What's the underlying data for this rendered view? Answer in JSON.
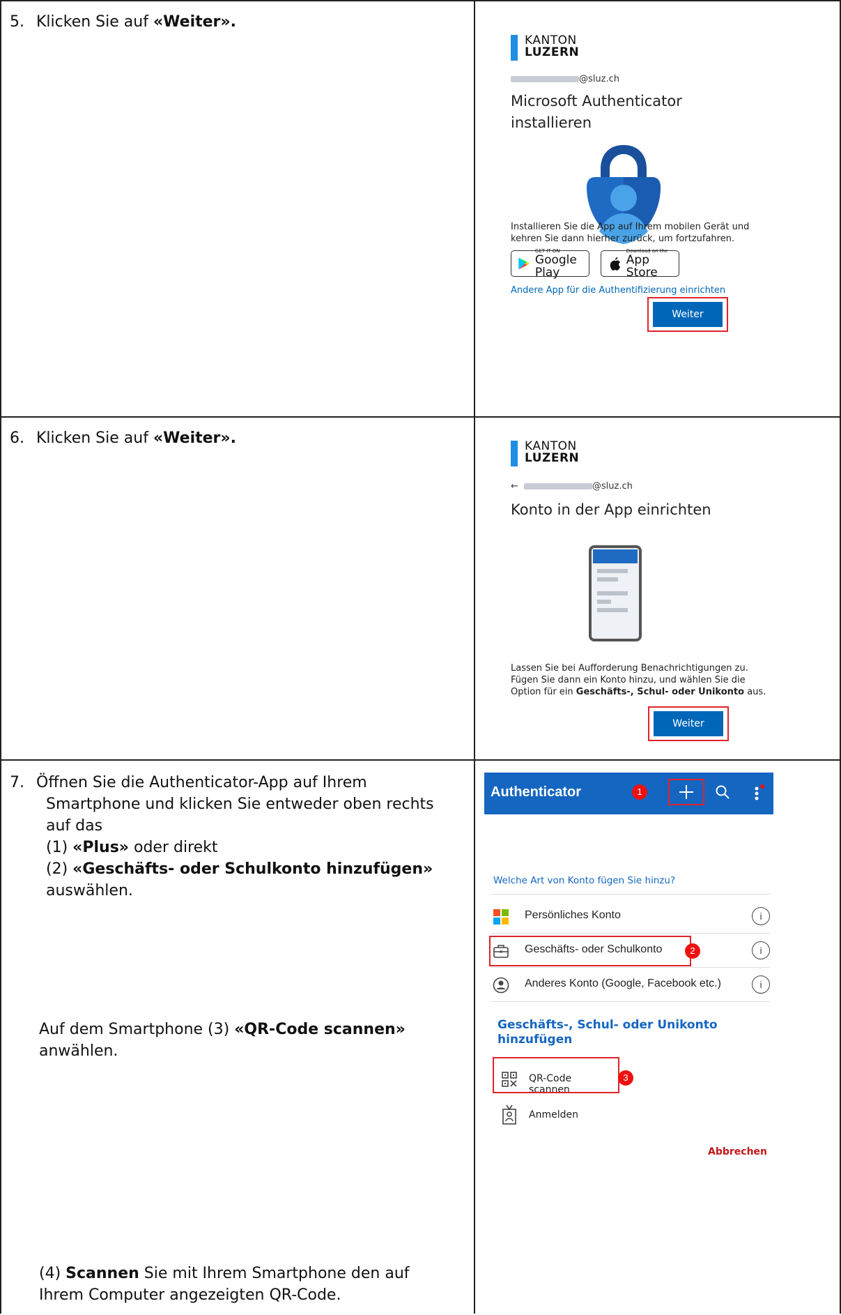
{
  "steps": {
    "s5": {
      "num": "5.",
      "pre": "Klicken Sie auf ",
      "bold": "«Weiter»."
    },
    "s6": {
      "num": "6.",
      "pre": "Klicken Sie auf ",
      "bold": "«Weiter»."
    },
    "s7": {
      "num": "7.",
      "line1": "Öffnen Sie die Authenticator-App auf Ihrem",
      "line2": "Smartphone und klicken Sie entweder oben rechts",
      "line3": "auf das",
      "l4_pre": "(1) ",
      "l4_bold": "«Plus»",
      "l4_post": " oder direkt",
      "l5_pre": "(2) ",
      "l5_bold": "«Geschäfts- oder Schulkonto hinzufügen»",
      "line6": "auswählen.",
      "qr_pre": "Auf dem Smartphone (3) ",
      "qr_bold": "«QR-Code scannen»",
      "qr_line2": "anwählen.",
      "scan_pre": "(4) ",
      "scan_bold": "Scannen",
      "scan_post": " Sie mit Ihrem Smartphone den auf",
      "scan_line2": "Ihrem Computer angezeigten QR-Code."
    }
  },
  "screen1": {
    "logo_line1": "KANTON",
    "logo_line2": "LUZERN",
    "email_domain": "@sluz.ch",
    "title_line1": "Microsoft Authenticator",
    "title_line2": "installieren",
    "para_line1": "Installieren Sie die App auf Ihrem mobilen Gerät und",
    "para_line2": "kehren Sie dann hierher zurück, um fortzufahren.",
    "google_small": "GET IT ON",
    "google_big": "Google Play",
    "apple_small": "Download on the",
    "apple_big": "App Store",
    "link": "Andere App für die Authentifizierung einrichten",
    "button": "Weiter"
  },
  "screen2": {
    "logo_line1": "KANTON",
    "logo_line2": "LUZERN",
    "back_arrow": "←",
    "email_domain": "@sluz.ch",
    "title": "Konto in der App einrichten",
    "para_line1": "Lassen Sie bei Aufforderung Benachrichtigungen zu.",
    "para_line2": "Fügen Sie dann ein Konto hinzu, und wählen Sie die",
    "para_line3_pre": "Option für ein ",
    "para_line3_bold": "Geschäfts-, Schul- oder Unikonto",
    "para_line3_post": " aus.",
    "button": "Weiter"
  },
  "screen3": {
    "app_title": "Authenticator",
    "badge1": "1",
    "badge2": "2",
    "badge3": "3",
    "question": "Welche Art von Konto fügen Sie hinzu?",
    "accounts": [
      {
        "label": "Persönliches Konto",
        "icon": "microsoft-logo-icon"
      },
      {
        "label": "Geschäfts- oder Schulkonto",
        "icon": "briefcase-icon"
      },
      {
        "label": "Anderes Konto (Google, Facebook etc.)",
        "icon": "person-circle-icon"
      }
    ],
    "info_glyph": "i",
    "section_title_line1": "Geschäfts-, Schul- oder Unikonto",
    "section_title_line2": "hinzufügen",
    "qr_label": "QR-Code scannen",
    "signin_label": "Anmelden",
    "cancel": "Abbrechen",
    "colors": {
      "header": "#1566c0",
      "accent": "#1566c0",
      "cancel": "#c21818",
      "badge": "#e11111",
      "highlight": "#e0232a"
    }
  }
}
